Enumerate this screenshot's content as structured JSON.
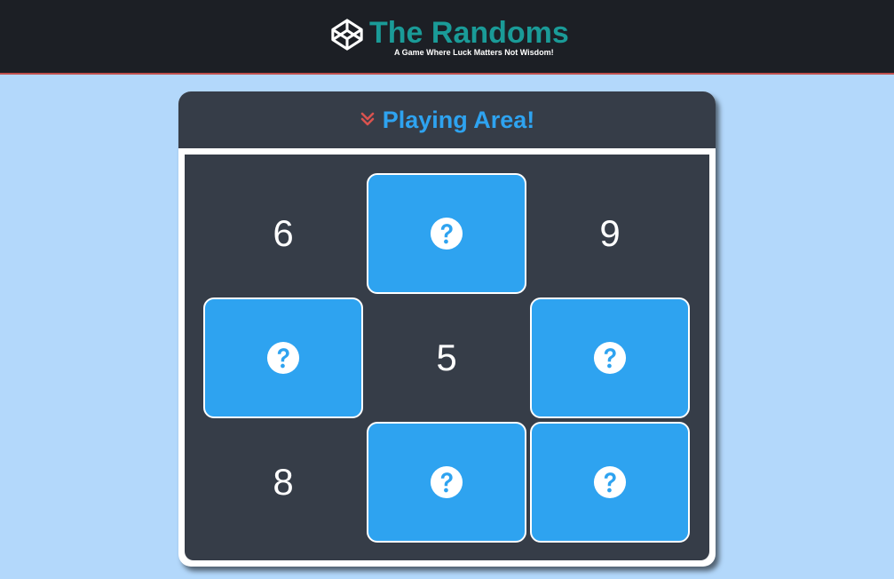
{
  "header": {
    "title": "The Randoms",
    "tagline": "A Game Where Luck Matters Not Wisdom!",
    "logo_icon": "codepen-cube-icon",
    "title_color": "#1a9b98",
    "bar_color": "#1c1f25",
    "accent_border": "#c0504d"
  },
  "panel": {
    "title": "Playing Area!",
    "title_icon": "double-chevron-down-icon",
    "title_color": "#2ea3f0",
    "chevron_color": "#d9534f"
  },
  "board": {
    "tile_color": "#2ea3f0",
    "hidden_icon": "question-circle-icon",
    "cells": [
      {
        "row": 1,
        "col": 1,
        "state": "revealed",
        "value": "6"
      },
      {
        "row": 1,
        "col": 2,
        "state": "hidden",
        "value": ""
      },
      {
        "row": 1,
        "col": 3,
        "state": "revealed",
        "value": "9"
      },
      {
        "row": 2,
        "col": 1,
        "state": "hidden",
        "value": ""
      },
      {
        "row": 2,
        "col": 2,
        "state": "revealed",
        "value": "5"
      },
      {
        "row": 2,
        "col": 3,
        "state": "hidden",
        "value": ""
      },
      {
        "row": 3,
        "col": 1,
        "state": "revealed",
        "value": "8"
      },
      {
        "row": 3,
        "col": 2,
        "state": "hidden",
        "value": ""
      },
      {
        "row": 3,
        "col": 3,
        "state": "hidden",
        "value": ""
      }
    ]
  }
}
